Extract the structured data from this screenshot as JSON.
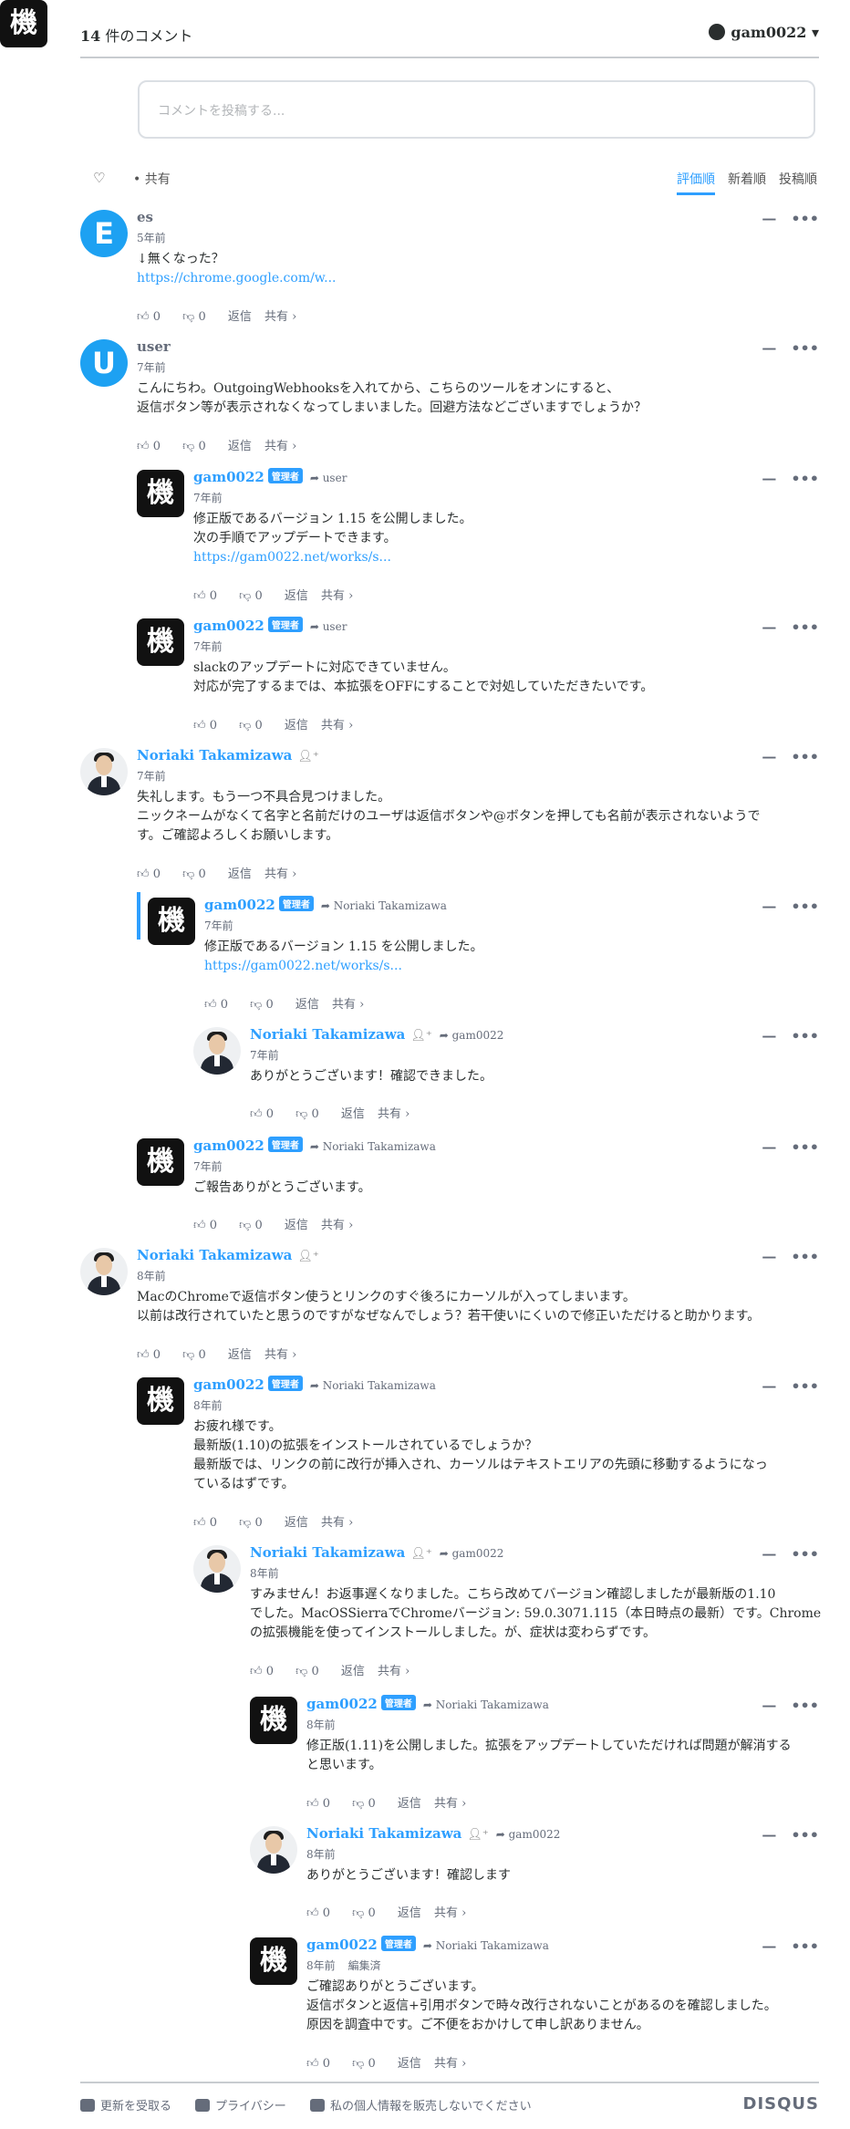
{
  "header": {
    "comment_count_number": "14",
    "comment_count_suffix": "件のコメント",
    "username": "gam0022 ▾"
  },
  "compose": {
    "placeholder": "コメントを投稿する..."
  },
  "toolbar": {
    "share": "• 共有",
    "sort_best": "評価順",
    "sort_newest": "新着順",
    "sort_oldest": "投稿順"
  },
  "labels": {
    "like_count": "0",
    "dislike_count": "0",
    "reply": "返信",
    "share": "共有 ›",
    "mod": "管理者",
    "collapse": "—",
    "menu": "•••",
    "edited": "編集済"
  },
  "comments": [
    {
      "author": "es",
      "time": "5年前",
      "lines": [
        "↓無くなった？"
      ],
      "link": "https://chrome.google.com/w..."
    },
    {
      "author": "user",
      "time": "7年前",
      "lines": [
        "こんにちわ。OutgoingWebhooksを入れてから、こちらのツールをオンにすると、",
        "返信ボタン等が表示されなくなってしまいました。回避方法などございますでしょうか？"
      ]
    },
    {
      "author": "gam0022",
      "reply_to": "user",
      "time": "7年前",
      "lines": [
        "修正版であるバージョン 1.15 を公開しました。",
        "次の手順でアップデートできます。"
      ],
      "link": "https://gam0022.net/works/s..."
    },
    {
      "author": "gam0022",
      "reply_to": "user",
      "time": "7年前",
      "lines": [
        "slackのアップデートに対応できていません。",
        "対応が完了するまでは、本拡張をOFFにすることで対処していただきたいです。"
      ]
    },
    {
      "author": "Noriaki Takamizawa",
      "time": "7年前",
      "lines": [
        "失礼します。もう一つ不具合見つけました。",
        "ニックネームがなくて名字と名前だけのユーザは返信ボタンや@ボタンを押しても名前が表示されないようで",
        "す。ご確認よろしくお願いします。"
      ]
    },
    {
      "author": "gam0022",
      "reply_to": "Noriaki Takamizawa",
      "time": "7年前",
      "lines": [
        "修正版であるバージョン 1.15 を公開しました。"
      ],
      "link": "https://gam0022.net/works/s..."
    },
    {
      "author": "Noriaki Takamizawa",
      "reply_to": "gam0022",
      "time": "7年前",
      "lines": [
        "ありがとうございます！確認できました。"
      ]
    },
    {
      "author": "gam0022",
      "reply_to": "Noriaki Takamizawa",
      "time": "7年前",
      "lines": [
        "ご報告ありがとうございます。"
      ]
    },
    {
      "author": "Noriaki Takamizawa",
      "time": "8年前",
      "lines": [
        "MacのChromeで返信ボタン使うとリンクのすぐ後ろにカーソルが入ってしまいます。",
        "以前は改行されていたと思うのですがなぜなんでしょう？若干使いにくいので修正いただけると助かります。"
      ]
    },
    {
      "author": "gam0022",
      "reply_to": "Noriaki Takamizawa",
      "time": "8年前",
      "lines": [
        "お疲れ様です。",
        "最新版(1.10)の拡張をインストールされているでしょうか？",
        "最新版では、リンクの前に改行が挿入され、カーソルはテキストエリアの先頭に移動するようになっ",
        "ているはずです。"
      ]
    },
    {
      "author": "Noriaki Takamizawa",
      "reply_to": "gam0022",
      "time": "8年前",
      "lines": [
        "すみません！お返事遅くなりました。こちら改めてバージョン確認しましたが最新版の1.10",
        "でした。MacOSSierraでChromeバージョン: 59.0.3071.115（本日時点の最新）です。Chrome",
        "の拡張機能を使ってインストールしました。が、症状は変わらずです。"
      ]
    },
    {
      "author": "gam0022",
      "reply_to": "Noriaki Takamizawa",
      "time": "8年前",
      "lines": [
        "修正版(1.11)を公開しました。拡張をアップデートしていただければ問題が解消する",
        "と思います。"
      ]
    },
    {
      "author": "Noriaki Takamizawa",
      "reply_to": "gam0022",
      "time": "8年前",
      "lines": [
        "ありがとうございます！確認します"
      ]
    },
    {
      "author": "gam0022",
      "reply_to": "Noriaki Takamizawa",
      "time": "8年前",
      "lines": [
        "ご確認ありがとうございます。",
        "返信ボタンと返信+引用ボタンで時々改行されないことがあるのを確認しました。",
        "原因を調査中です。ご不便をおかけして申し訳ありません。"
      ]
    }
  ],
  "footer": {
    "subscribe": "更新を受取る",
    "privacy": "プライバシー",
    "do_not_sell": "私の個人情報を販売しないでください",
    "brand": "DISQUS"
  },
  "avatar_letters": {
    "es": "E",
    "user": "U",
    "gam0022": "機"
  },
  "colors": {
    "accent": "#2e9fff",
    "text": "#2a2e2e",
    "muted": "#656c7a"
  }
}
